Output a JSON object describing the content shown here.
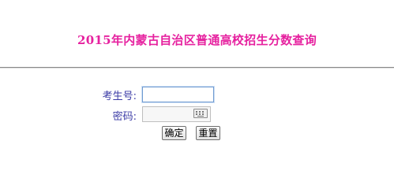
{
  "header": {
    "title": "2015年内蒙古自治区普通高校招生分数查询"
  },
  "form": {
    "exam_number_label": "考生号:",
    "exam_number_value": "",
    "password_label": "密码:",
    "password_value": "",
    "submit_label": "确定",
    "reset_label": "重置"
  },
  "icons": {
    "password_keyboard": "keyboard-icon"
  },
  "colors": {
    "title": "#e6219f",
    "labels": "#3b3ba6",
    "divider": "#8a8a8a",
    "background": "#ffffff"
  }
}
